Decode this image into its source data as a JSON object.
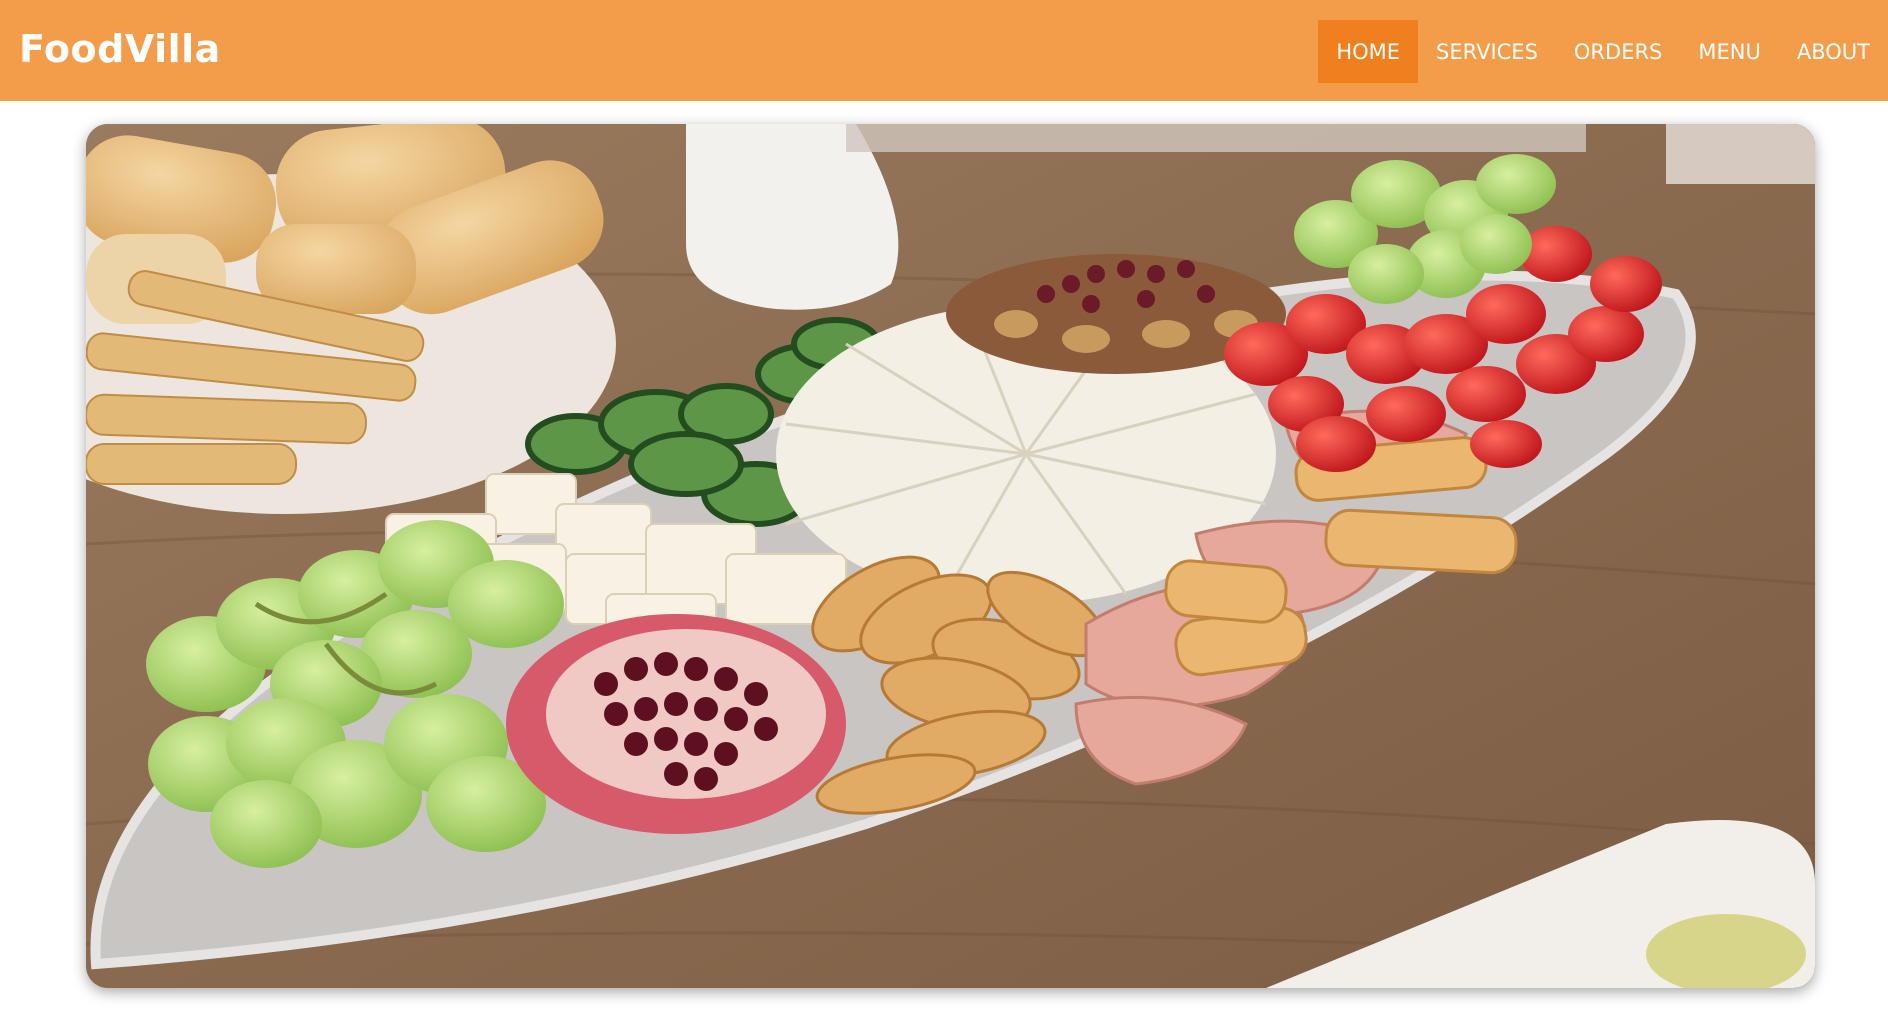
{
  "navbar": {
    "brand": "FoodVilla",
    "background_color": "#f39c4a",
    "active_color": "#f07f1e",
    "items": [
      {
        "label": "HOME",
        "active": true
      },
      {
        "label": "SERVICES",
        "active": false
      },
      {
        "label": "ORDERS",
        "active": false
      },
      {
        "label": "MENU",
        "active": false
      },
      {
        "label": "ABOUT",
        "active": false
      }
    ]
  },
  "hero": {
    "image_subject": "charcuterie platter"
  }
}
